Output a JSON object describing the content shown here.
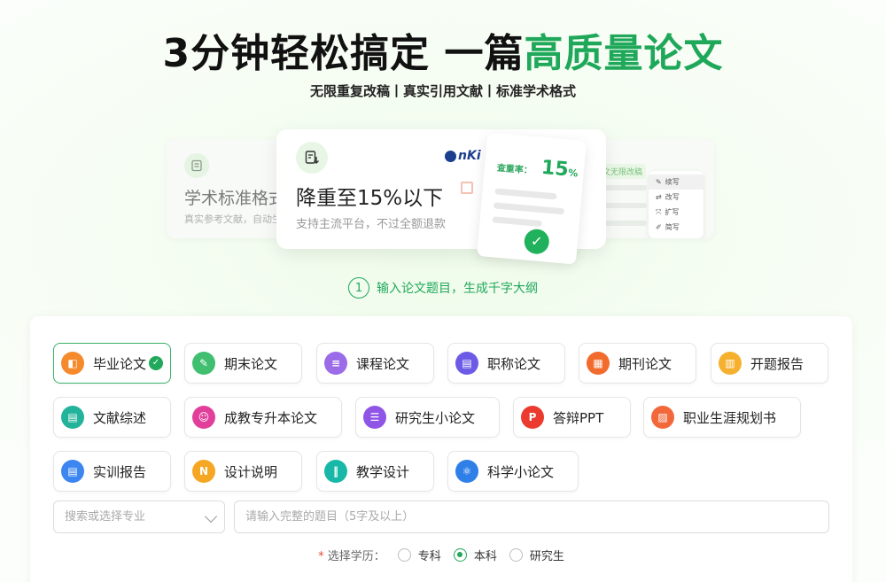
{
  "hero": {
    "title_main": "3分钟轻松搞定 一篇",
    "title_highlight": "高质量论文",
    "subtitle": "无限重复改稿丨真实引用文献丨标准学术格式"
  },
  "carousel": {
    "left": {
      "title": "学术标准格式",
      "desc": "真实参考文献，自动生成"
    },
    "main": {
      "title": "降重至15%以下",
      "desc": "支持主流平台，不过全额退款",
      "logo_text": "nKi",
      "report_label": "查重率：",
      "report_value": "15",
      "report_unit": "%"
    },
    "right": {
      "tag": "文无限改稿",
      "menu": [
        "续写",
        "改写",
        "扩写",
        "简写"
      ]
    }
  },
  "step": {
    "number": "1",
    "text": "输入论文题目，生成千字大纲"
  },
  "types": [
    {
      "label": "毕业论文",
      "icon": "graduation-icon",
      "color": "#f58a2c",
      "selected": true
    },
    {
      "label": "期末论文",
      "icon": "pen-icon",
      "color": "#3fbf6f"
    },
    {
      "label": "课程论文",
      "icon": "book-icon",
      "color": "#9b6be8"
    },
    {
      "label": "职称论文",
      "icon": "certificate-icon",
      "color": "#6b5be6"
    },
    {
      "label": "期刊论文",
      "icon": "journal-icon",
      "color": "#f26b2c"
    },
    {
      "label": "开题报告",
      "icon": "report-icon",
      "color": "#f5b12e"
    },
    {
      "label": "文献综述",
      "icon": "document-icon",
      "color": "#23b39a"
    },
    {
      "label": "成教专升本论文",
      "icon": "person-icon",
      "color": "#e23f9b"
    },
    {
      "label": "研究生小论文",
      "icon": "list-icon",
      "color": "#8f55e6"
    },
    {
      "label": "答辩PPT",
      "icon": "ppt-icon",
      "color": "#ea3b2e"
    },
    {
      "label": "职业生涯规划书",
      "icon": "chart-icon",
      "color": "#f2683a"
    },
    {
      "label": "实训报告",
      "icon": "file-icon",
      "color": "#3b86f0"
    },
    {
      "label": "设计说明",
      "icon": "design-icon",
      "color": "#f5a623"
    },
    {
      "label": "教学设计",
      "icon": "teach-icon",
      "color": "#18b8a8"
    },
    {
      "label": "科学小论文",
      "icon": "atom-icon",
      "color": "#2f7fe8"
    }
  ],
  "form": {
    "major_placeholder": "搜索或选择专业",
    "topic_placeholder": "请输入完整的题目（5字及以上）",
    "degree_required": "*",
    "degree_label": "选择学历：",
    "degrees": [
      "专科",
      "本科",
      "研究生"
    ],
    "degree_selected": "本科"
  }
}
